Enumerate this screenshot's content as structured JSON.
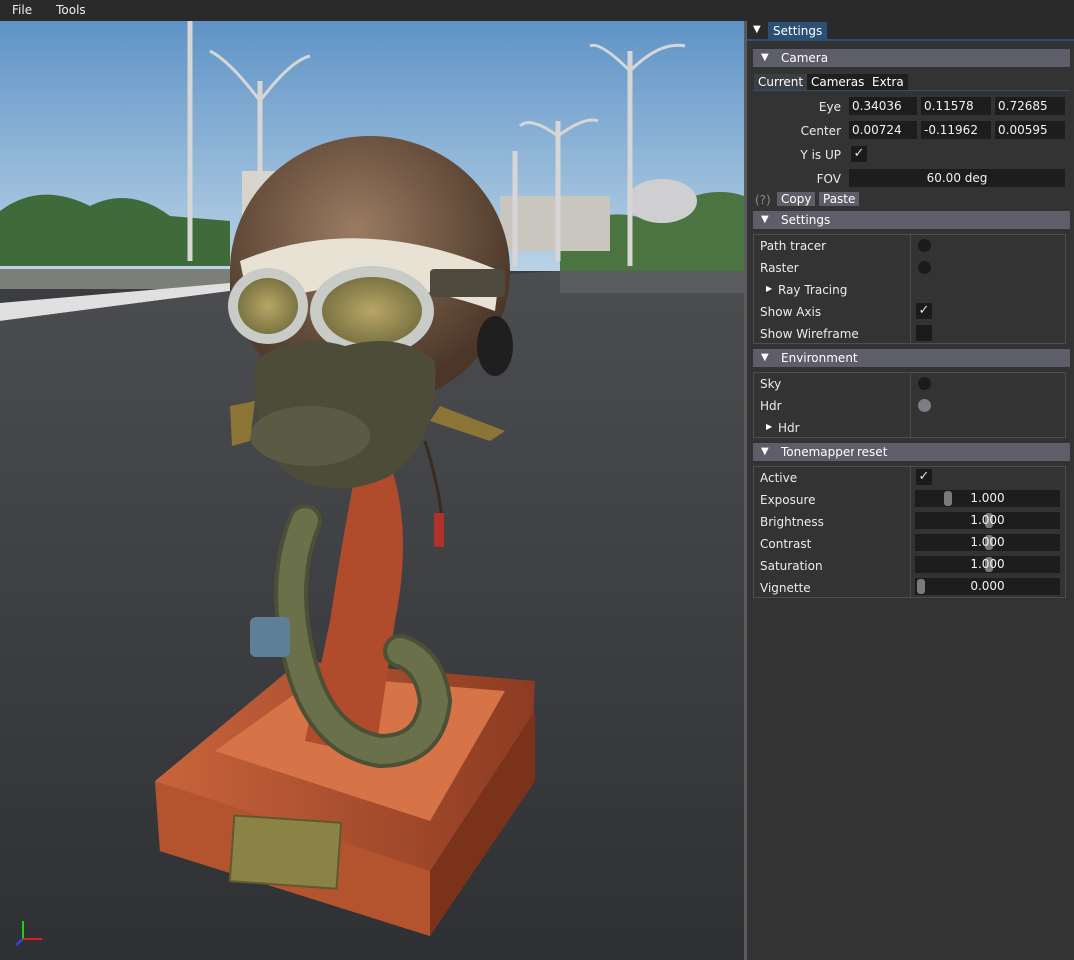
{
  "menubar": {
    "items": [
      "File",
      "Tools"
    ]
  },
  "panel": {
    "tab": "Settings",
    "camera": {
      "title": "Camera",
      "tabs": [
        "Current",
        "Cameras",
        "Extra"
      ],
      "eye_label": "Eye",
      "eye": [
        "0.34036",
        "0.11578",
        "0.72685"
      ],
      "center_label": "Center",
      "center": [
        "0.00724",
        "-0.11962",
        "0.00595"
      ],
      "y_is_up_label": "Y is UP",
      "y_is_up": true,
      "fov_label": "FOV",
      "fov_value": "60.00 deg",
      "help": "(?)",
      "copy": "Copy",
      "paste": "Paste"
    },
    "settings": {
      "title": "Settings",
      "path_tracer": "Path tracer",
      "raster": "Raster",
      "ray_tracing": "Ray Tracing",
      "show_axis": "Show Axis",
      "show_axis_checked": true,
      "show_wireframe": "Show Wireframe",
      "show_wireframe_checked": false
    },
    "environment": {
      "title": "Environment",
      "sky": "Sky",
      "hdr": "Hdr",
      "hdr_node": "Hdr"
    },
    "tonemapper": {
      "title": "Tonemapper",
      "reset": "reset",
      "active": "Active",
      "active_checked": true,
      "rows": [
        {
          "label": "Exposure",
          "value": "1.000",
          "fraction": 0.2
        },
        {
          "label": "Brightness",
          "value": "1.000",
          "fraction": 0.5
        },
        {
          "label": "Contrast",
          "value": "1.000",
          "fraction": 0.5
        },
        {
          "label": "Saturation",
          "value": "1.000",
          "fraction": 0.5
        },
        {
          "label": "Vignette",
          "value": "0.000",
          "fraction": 0.0
        }
      ]
    }
  },
  "colors": {
    "accent": "#2b4f75",
    "header": "#5e5e6a",
    "panel_bg": "#333333"
  }
}
